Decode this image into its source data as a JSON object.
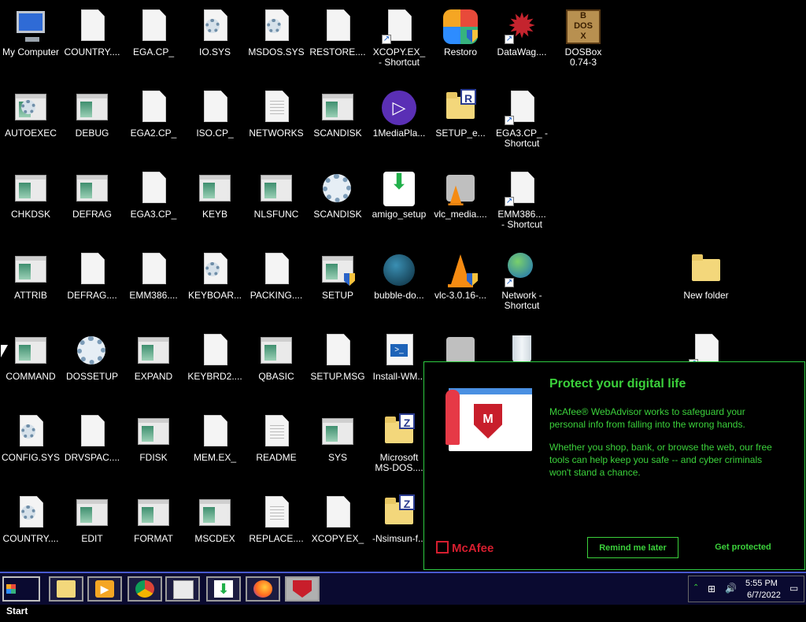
{
  "desktop": {
    "icons": [
      {
        "label": "My Computer",
        "kind": "monitor"
      },
      {
        "label": "COUNTRY....",
        "kind": "doc"
      },
      {
        "label": "EGA.CP_",
        "kind": "doc"
      },
      {
        "label": "IO.SYS",
        "kind": "gear-doc"
      },
      {
        "label": "MSDOS.SYS",
        "kind": "gear-doc"
      },
      {
        "label": "RESTORE....",
        "kind": "doc"
      },
      {
        "label": "XCOPY.EX_\n- Shortcut",
        "kind": "doc-shortcut"
      },
      {
        "label": "Restoro",
        "kind": "restoro"
      },
      {
        "label": "DataWag....",
        "kind": "star-shortcut"
      },
      {
        "label": "DOSBox\n0.74-3",
        "kind": "dosbox"
      },
      {
        "label": "AUTOEXEC",
        "kind": "gear-win"
      },
      {
        "label": "DEBUG",
        "kind": "win"
      },
      {
        "label": "EGA2.CP_",
        "kind": "doc"
      },
      {
        "label": "ISO.CP_",
        "kind": "doc"
      },
      {
        "label": "NETWORKS",
        "kind": "doc-lines"
      },
      {
        "label": "SCANDISK",
        "kind": "win"
      },
      {
        "label": "1MediaPla...",
        "kind": "mediaplay"
      },
      {
        "label": "SETUP_e...",
        "kind": "folder-r"
      },
      {
        "label": "EGA3.CP_ -\nShortcut",
        "kind": "doc-shortcut"
      },
      {
        "label": "CHKDSK",
        "kind": "win"
      },
      {
        "label": "DEFRAG",
        "kind": "win"
      },
      {
        "label": "EGA3.CP_",
        "kind": "doc"
      },
      {
        "label": "KEYB",
        "kind": "win"
      },
      {
        "label": "NLSFUNC",
        "kind": "win"
      },
      {
        "label": "SCANDISK",
        "kind": "gear-big"
      },
      {
        "label": "amigo_setup",
        "kind": "amigo"
      },
      {
        "label": "vlc_media....",
        "kind": "vlc-setup"
      },
      {
        "label": "EMM386....\n- Shortcut",
        "kind": "doc-shortcut"
      },
      {
        "label": "ATTRIB",
        "kind": "win"
      },
      {
        "label": "DEFRAG....",
        "kind": "doc"
      },
      {
        "label": "EMM386....",
        "kind": "doc"
      },
      {
        "label": "KEYBOAR...",
        "kind": "gear-doc"
      },
      {
        "label": "PACKING....",
        "kind": "doc"
      },
      {
        "label": "SETUP",
        "kind": "win-shield"
      },
      {
        "label": "bubble-do...",
        "kind": "bubble"
      },
      {
        "label": "vlc-3.0.16-...",
        "kind": "vlc"
      },
      {
        "label": "Network -\nShortcut",
        "kind": "globe"
      },
      {
        "label": "New folder",
        "kind": "newfolder"
      },
      {
        "label": "COMMAND",
        "kind": "win"
      },
      {
        "label": "DOSSETUP",
        "kind": "gear-big"
      },
      {
        "label": "EXPAND",
        "kind": "win"
      },
      {
        "label": "KEYBRD2....",
        "kind": "doc"
      },
      {
        "label": "QBASIC",
        "kind": "win"
      },
      {
        "label": "SETUP.MSG",
        "kind": "doc"
      },
      {
        "label": "Install-WM...",
        "kind": "ps"
      },
      {
        "label": "",
        "kind": "cdstack"
      },
      {
        "label": "",
        "kind": "bin"
      },
      {
        "label": "",
        "kind": "doc-shortcut"
      },
      {
        "label": "CONFIG.SYS",
        "kind": "gear-doc"
      },
      {
        "label": "DRVSPAC....",
        "kind": "doc"
      },
      {
        "label": "FDISK",
        "kind": "win"
      },
      {
        "label": "MEM.EX_",
        "kind": "doc"
      },
      {
        "label": "README",
        "kind": "doc-lines"
      },
      {
        "label": "SYS",
        "kind": "win"
      },
      {
        "label": "Microsoft\nMS-DOS....",
        "kind": "folder-z"
      },
      {
        "label": "COUNTRY....",
        "kind": "gear-doc"
      },
      {
        "label": "EDIT",
        "kind": "win"
      },
      {
        "label": "FORMAT",
        "kind": "win"
      },
      {
        "label": "MSCDEX",
        "kind": "win"
      },
      {
        "label": "REPLACE....",
        "kind": "doc-lines"
      },
      {
        "label": "XCOPY.EX_",
        "kind": "doc"
      },
      {
        "label": "-Nsimsun-f...",
        "kind": "folder-z"
      }
    ]
  },
  "popup": {
    "title": "Protect your digital life",
    "p1": "McAfee® WebAdvisor works to safeguard your personal info from falling into the wrong hands.",
    "p2": "Whether you shop, bank, or browse the web, our free tools can help keep you safe -- and cyber criminals won't stand a chance.",
    "logo": "McAfee",
    "remind_label": "Remind me later",
    "protect_label": "Get protected"
  },
  "taskbar": {
    "start_label": "Start",
    "time": "5:55 PM",
    "date": "6/7/2022",
    "apps": [
      "file-explorer",
      "media-player",
      "chrome",
      "window-app",
      "amigo-download",
      "firefox",
      "mcafee"
    ]
  },
  "colors": {
    "accent_green": "#3bd13b",
    "mcafee_red": "#d61e2f",
    "taskbar_bg": "#0a0a30"
  }
}
